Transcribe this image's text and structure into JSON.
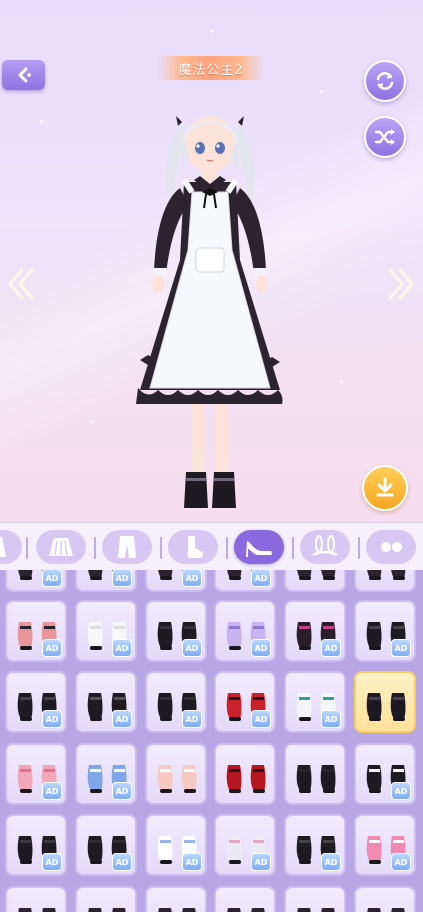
{
  "header": {
    "title": "魔法公主2"
  },
  "icons": {
    "back": "back-arrow-icon",
    "rotate": "rotate-icon",
    "shuffle": "shuffle-icon",
    "prev": "double-chevron-left-icon",
    "next": "double-chevron-right-icon",
    "download": "download-icon"
  },
  "categories": [
    {
      "name": "dress",
      "active": false
    },
    {
      "name": "skirt",
      "active": false
    },
    {
      "name": "pants",
      "active": false
    },
    {
      "name": "socks",
      "active": false
    },
    {
      "name": "shoes",
      "active": true
    },
    {
      "name": "ears",
      "active": false
    },
    {
      "name": "accessory",
      "active": false
    }
  ],
  "ad_label": "AD",
  "colors": {
    "accent": "#8a68dd",
    "grid_bg": "#b7a7e4",
    "selected": "#ffe29a",
    "download": "#f5a623"
  },
  "items": [
    [
      {
        "ad": true
      },
      {
        "ad": true
      },
      {
        "ad": true
      },
      {
        "ad": true
      },
      {
        "ad": false
      },
      {
        "ad": false
      }
    ],
    [
      {
        "ad": true,
        "style": "pink-lace"
      },
      {
        "ad": true,
        "style": "white-strap"
      },
      {
        "ad": true,
        "style": "black-ribbon"
      },
      {
        "ad": true,
        "style": "lilac-bow"
      },
      {
        "ad": true,
        "style": "black-boot-pink"
      },
      {
        "ad": true,
        "style": "black-mary-jane"
      }
    ],
    [
      {
        "ad": true,
        "style": "black-bunny"
      },
      {
        "ad": true,
        "style": "black-lace-up"
      },
      {
        "ad": true,
        "style": "black-cross"
      },
      {
        "ad": true,
        "style": "red-platform"
      },
      {
        "ad": true,
        "style": "teal-sneaker"
      },
      {
        "ad": false,
        "style": "black-mary-jane",
        "selected": true
      }
    ],
    [
      {
        "ad": true,
        "style": "pink-sandal"
      },
      {
        "ad": true,
        "style": "blue-ribbon"
      },
      {
        "ad": false,
        "style": "pink-slipper"
      },
      {
        "ad": false,
        "style": "red-strap"
      },
      {
        "ad": false,
        "style": "black-wing"
      },
      {
        "ad": true,
        "style": "black-mary-jane-2"
      }
    ],
    [
      {
        "ad": true,
        "style": "black-flat"
      },
      {
        "ad": true,
        "style": "black-boot"
      },
      {
        "ad": true,
        "style": "white-cat"
      },
      {
        "ad": true,
        "style": "pearl-sandal"
      },
      {
        "ad": true,
        "style": "black-heart"
      },
      {
        "ad": true,
        "style": "pink-sneaker"
      }
    ],
    [
      {
        "ad": false
      },
      {
        "ad": false
      },
      {
        "ad": false
      },
      {
        "ad": false
      },
      {
        "ad": false
      },
      {
        "ad": false
      }
    ]
  ]
}
